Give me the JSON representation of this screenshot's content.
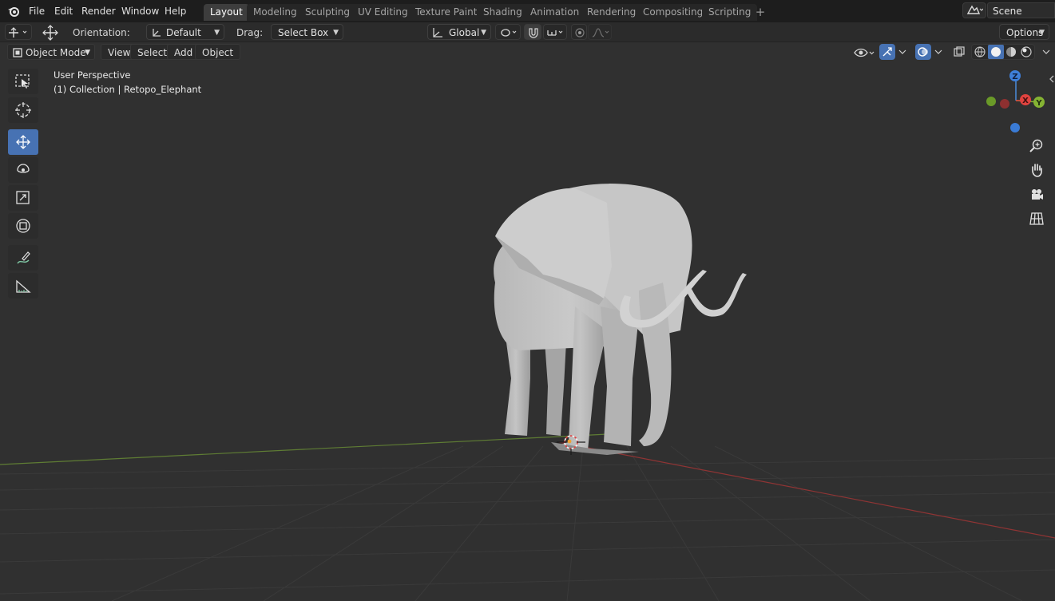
{
  "menu": {
    "items": [
      {
        "id": "file",
        "label": "File"
      },
      {
        "id": "edit",
        "label": "Edit"
      },
      {
        "id": "render",
        "label": "Render"
      },
      {
        "id": "window",
        "label": "Window"
      },
      {
        "id": "help",
        "label": "Help"
      }
    ]
  },
  "workspaces": {
    "tabs": [
      {
        "label": "Layout",
        "active": true
      },
      {
        "label": "Modeling"
      },
      {
        "label": "Sculpting"
      },
      {
        "label": "UV Editing"
      },
      {
        "label": "Texture Paint"
      },
      {
        "label": "Shading"
      },
      {
        "label": "Animation"
      },
      {
        "label": "Rendering"
      },
      {
        "label": "Compositing"
      },
      {
        "label": "Scripting"
      }
    ],
    "add_icon": "plus-icon"
  },
  "scene": {
    "name": "Scene"
  },
  "tool_settings": {
    "orientation_label": "Orientation:",
    "orientation_value": "Default",
    "drag_label": "Drag:",
    "drag_value": "Select Box",
    "transform_orientation": "Global",
    "options_label": "Options"
  },
  "viewport_header": {
    "mode": "Object Mode",
    "view": "View",
    "select": "Select",
    "add": "Add",
    "object": "Object"
  },
  "viewport": {
    "perspective": "User Perspective",
    "collection": "(1) Collection | Retopo_Elephant"
  },
  "gizmo": {
    "z": "Z",
    "x": "X",
    "y": "Y"
  },
  "tools": [
    {
      "name": "select-box-tool",
      "icon": "select-box-icon"
    },
    {
      "name": "cursor-tool",
      "icon": "cursor-icon"
    },
    {
      "name": "move-tool",
      "icon": "move-icon",
      "active": true
    },
    {
      "name": "rotate-tool",
      "icon": "rotate-icon"
    },
    {
      "name": "scale-tool",
      "icon": "scale-icon"
    },
    {
      "name": "transform-tool",
      "icon": "transform-icon"
    },
    {
      "name": "annotate-tool",
      "icon": "annotate-icon"
    },
    {
      "name": "measure-tool",
      "icon": "measure-icon"
    }
  ],
  "colors": {
    "accent": "#4772b3",
    "axis_x": "#e0433f",
    "axis_y": "#85b333",
    "axis_z": "#4a8cdb",
    "background": "#303030"
  }
}
